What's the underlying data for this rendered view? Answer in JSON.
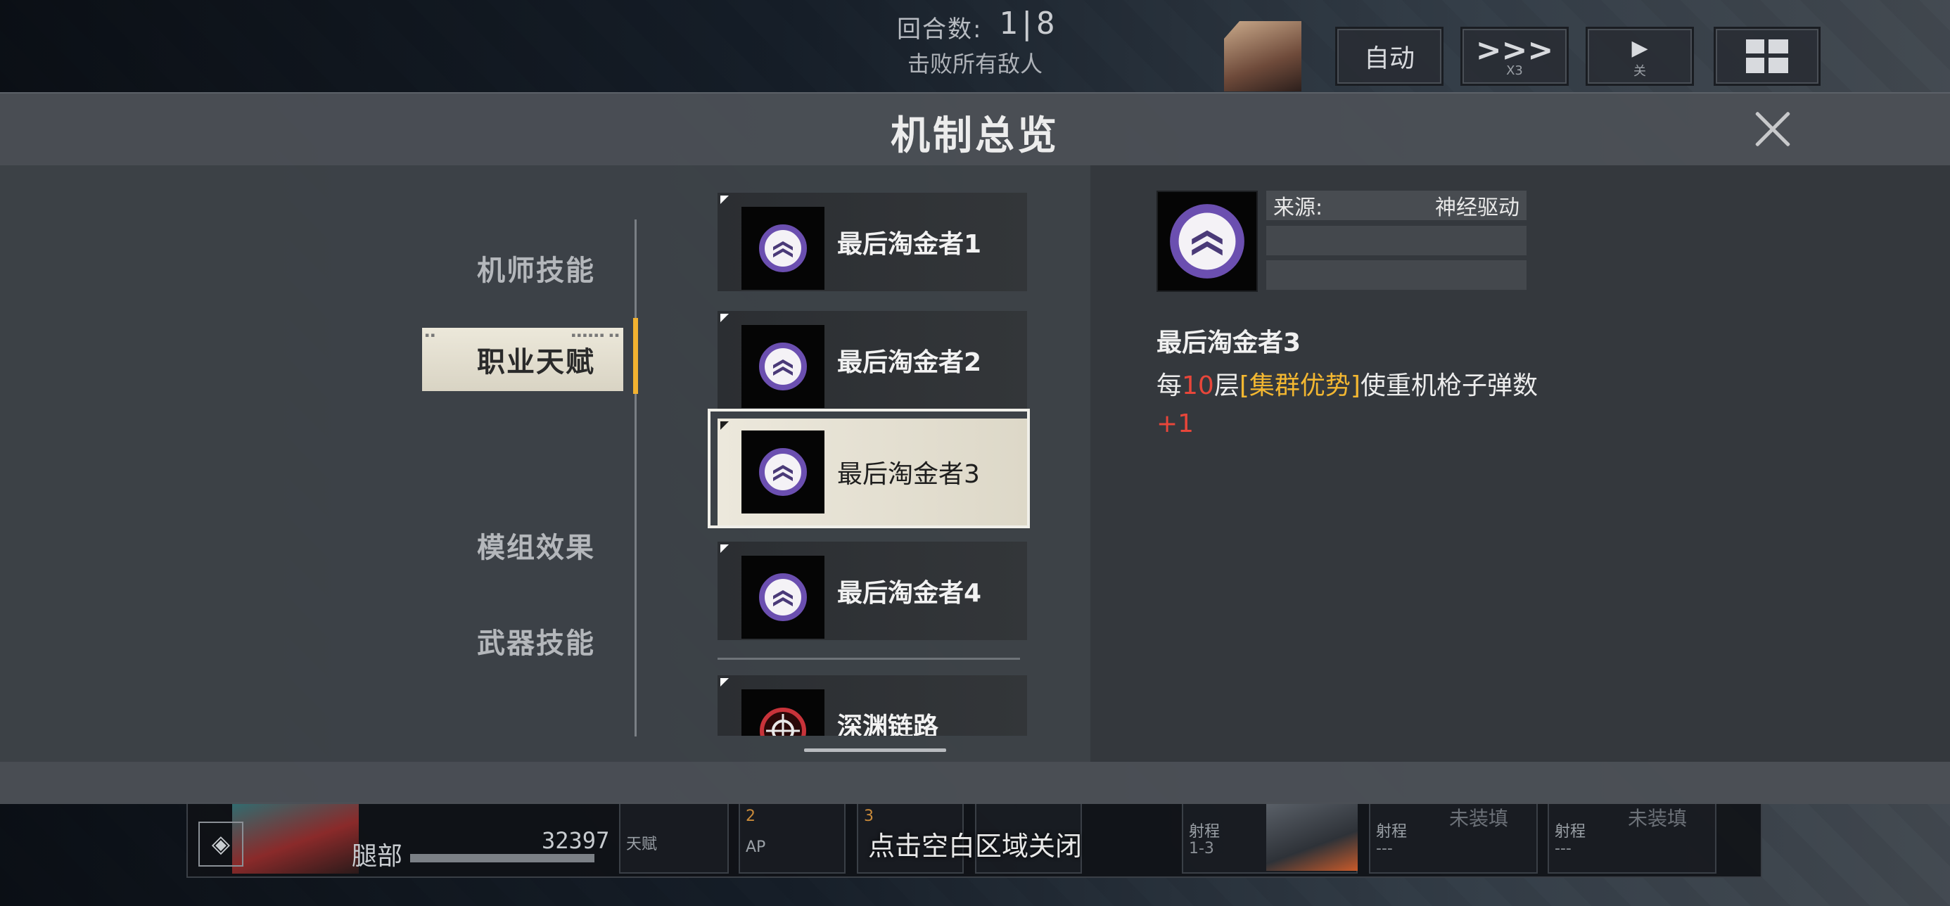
{
  "hud_top": {
    "round_label": "回合数:",
    "round_value": "1|8",
    "objective": "击败所有敌人",
    "buttons": [
      {
        "label": "自动",
        "sub": ""
      },
      {
        "label": ">>>",
        "sub": "X3"
      },
      {
        "label": "▶",
        "sub": "关"
      },
      {
        "label": "",
        "sub": ""
      }
    ]
  },
  "modal": {
    "title": "机制总览",
    "close_hint": "点击空白区域关闭",
    "categories": [
      {
        "label": "机师技能",
        "active": false
      },
      {
        "label": "职业天赋",
        "active": true
      },
      {
        "label": "模组效果",
        "active": false
      },
      {
        "label": "武器技能",
        "active": false
      }
    ],
    "items": [
      {
        "label": "最后淘金者1",
        "icon": "purple-chevron-emblem-icon",
        "selected": false
      },
      {
        "label": "最后淘金者2",
        "icon": "purple-chevron-emblem-icon",
        "selected": false
      },
      {
        "label": "最后淘金者3",
        "icon": "purple-chevron-emblem-icon",
        "selected": true
      },
      {
        "label": "最后淘金者4",
        "icon": "purple-chevron-emblem-icon",
        "selected": false
      },
      {
        "label": "深渊链路",
        "icon": "red-crosshair-emblem-icon",
        "selected": false
      }
    ],
    "detail": {
      "source_label": "来源:",
      "source_value": "神经驱动",
      "name": "最后淘金者3",
      "desc_prefix": "每",
      "desc_number": "10",
      "desc_mid": "层",
      "desc_keyword": "[集群优势]",
      "desc_suffix": "使重机枪子弹数",
      "desc_bonus": "+1"
    }
  },
  "hud_bottom": {
    "part_label": "腿部",
    "part_value": "32397",
    "slots": [
      {
        "k": "天赋"
      },
      {
        "k": "AP",
        "n": "2"
      },
      {
        "k": "",
        "n": "3"
      },
      {
        "k": "射程",
        "v": "1-3"
      },
      {
        "k": "射程",
        "v": "---",
        "big": "未装填"
      },
      {
        "k": "射程",
        "v": "---",
        "big": "未装填"
      }
    ]
  },
  "colors": {
    "accent_gold": "#f2b230",
    "highlight_red": "#e8463a",
    "keyword_gold": "#f3b731",
    "emblem_purple": "#6b4fb0"
  }
}
